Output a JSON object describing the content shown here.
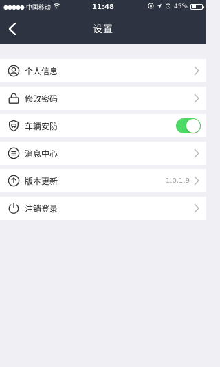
{
  "status_bar": {
    "carrier": "中国移动",
    "time": "11:48",
    "battery_percent": "45%",
    "battery_level": 0.45,
    "icons": [
      "signal-dots-icon",
      "wifi-icon",
      "orientation-lock-icon",
      "location-icon",
      "alarm-icon",
      "battery-icon"
    ]
  },
  "nav": {
    "title": "设置",
    "back_icon": "chevron-left-icon"
  },
  "settings": {
    "items": [
      {
        "label": "个人信息",
        "icon": "user-icon",
        "accessory": "chevron"
      },
      {
        "label": "修改密码",
        "icon": "lock-icon",
        "accessory": "chevron"
      },
      {
        "label": "车辆安防",
        "icon": "shield-icon",
        "accessory": "toggle",
        "toggle_on": true
      },
      {
        "label": "消息中心",
        "icon": "message-icon",
        "accessory": "chevron"
      },
      {
        "label": "版本更新",
        "icon": "upload-icon",
        "accessory": "chevron",
        "value": "1.0.1.9"
      },
      {
        "label": "注销登录",
        "icon": "power-icon",
        "accessory": "chevron"
      }
    ]
  },
  "colors": {
    "nav_background": "#2d3340",
    "page_background": "#efeff4",
    "toggle_on": "#4cd964",
    "secondary_text": "#999999"
  }
}
